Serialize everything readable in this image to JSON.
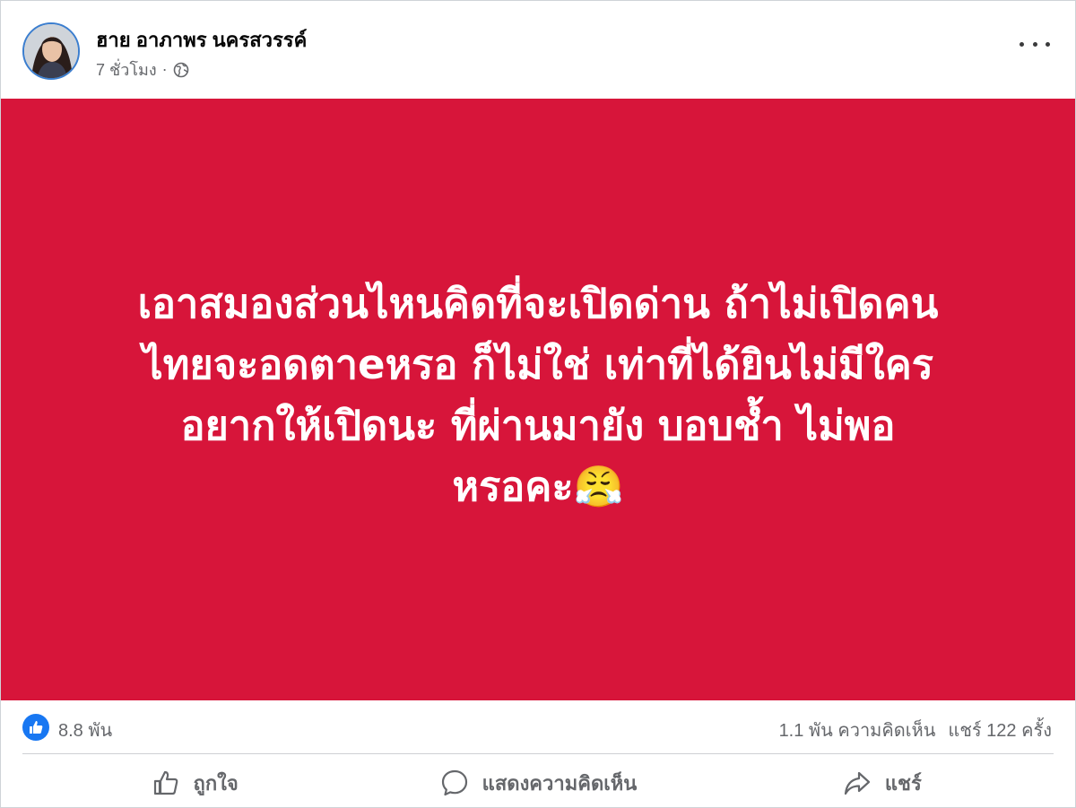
{
  "post": {
    "author": "ฮาย อาภาพร นครสวรรค์",
    "time": "7 ชั่วโมง",
    "separator": "·",
    "privacy_icon": "globe-icon",
    "more_icon": "more-options-icon",
    "banner": {
      "background_color": "#d7153a",
      "text_color": "#ffffff",
      "line_1": "เอาสมองส่วนไหนคิดที่จะเปิดด่าน ถ้าไม่เปิดคน",
      "line_2": "ไทยจะอดตาeหรอ ก็ไม่ใช่ เท่าที่ได้ยินไม่มีใคร",
      "line_3": "อยากให้เปิด￼นะ ที่ผ่านมายัง บอบช้ำ ￼ไม่พอ",
      "line_4": "หรอคะ😤"
    }
  },
  "stats": {
    "likes": "8.8 พัน",
    "comments": "1.1 พัน ความคิดเห็น",
    "shares": "แชร์ 122 ครั้ง",
    "like_badge_color": "#1877f2"
  },
  "actions": {
    "like_label": "ถูกใจ",
    "comment_label": "แสดงความคิดเห็น",
    "share_label": "แชร์"
  }
}
